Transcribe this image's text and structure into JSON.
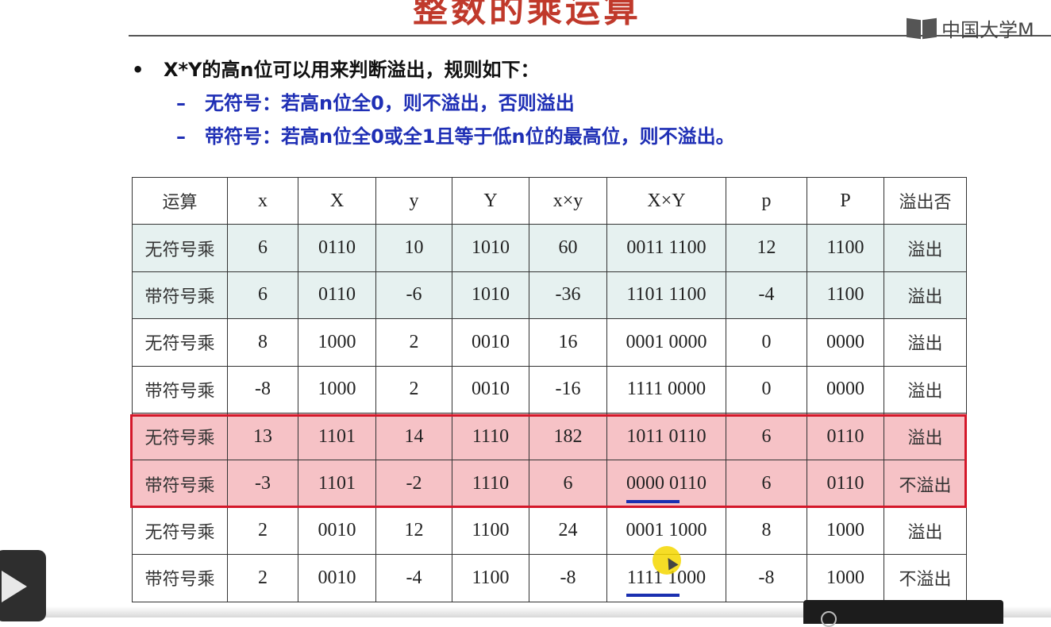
{
  "title": "整数的乘运算",
  "logo_text": "中国大学M",
  "bullet": {
    "marker": "•",
    "text": "X*Y的高n位可以用来判断溢出，规则如下："
  },
  "sub_items": [
    {
      "marker": "–",
      "text": "无符号：若高n位全0，则不溢出，否则溢出"
    },
    {
      "marker": "–",
      "text": "带符号：若高n位全0或全1且等于低n位的最高位，则不溢出。"
    }
  ],
  "table": {
    "headers": [
      "运算",
      "x",
      "X",
      "y",
      "Y",
      "x×y",
      "X×Y",
      "p",
      "P",
      "溢出否"
    ],
    "rows": [
      [
        "无符号乘",
        "6",
        "0110",
        "10",
        "1010",
        "60",
        "0011 1100",
        "12",
        "1100",
        "溢出"
      ],
      [
        "带符号乘",
        "6",
        "0110",
        "-6",
        "1010",
        "-36",
        "1101 1100",
        "-4",
        "1100",
        "溢出"
      ],
      [
        "无符号乘",
        "8",
        "1000",
        "2",
        "0010",
        "16",
        "0001 0000",
        "0",
        "0000",
        "溢出"
      ],
      [
        "带符号乘",
        "-8",
        "1000",
        "2",
        "0010",
        "-16",
        "1111 0000",
        "0",
        "0000",
        "溢出"
      ],
      [
        "无符号乘",
        "13",
        "1101",
        "14",
        "1110",
        "182",
        "1011 0110",
        "6",
        "0110",
        "溢出"
      ],
      [
        "带符号乘",
        "-3",
        "1101",
        "-2",
        "1110",
        "6",
        "0000 0110",
        "6",
        "0110",
        "不溢出"
      ],
      [
        "无符号乘",
        "2",
        "0010",
        "12",
        "1100",
        "24",
        "0001 1000",
        "8",
        "1000",
        "溢出"
      ],
      [
        "带符号乘",
        "2",
        "0010",
        "-4",
        "1100",
        "-8",
        "1111 1000",
        "-8",
        "1000",
        "不溢出"
      ]
    ]
  },
  "colors": {
    "title": "#c0392b",
    "sub_text": "#1f2fb5",
    "green_row": "#e6f1f0",
    "red_row": "#f6c2c6",
    "red_box": "#d4182a",
    "underline": "#1a2fb0",
    "cursor": "#f5d700"
  },
  "icons": {
    "logo": "book-icon",
    "player": "play-icon"
  }
}
